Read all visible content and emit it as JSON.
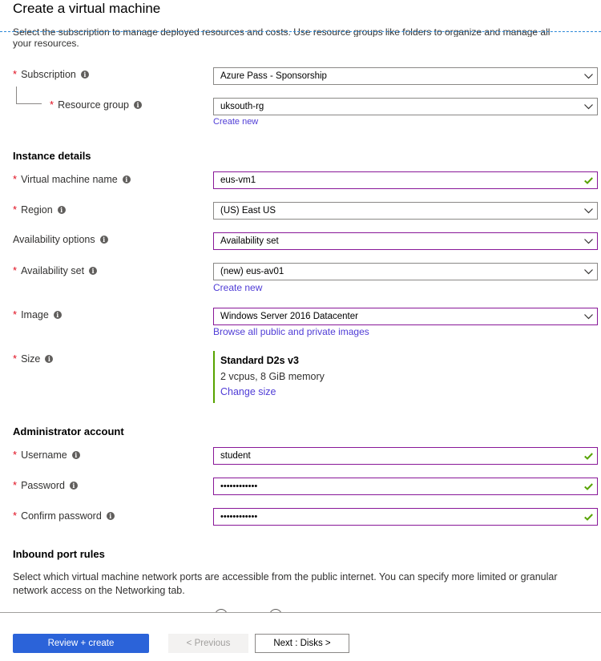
{
  "header": {
    "title": "Create a virtual machine",
    "intro_line1": "Select the subscription to manage deployed resources and costs. Use resource groups like folders to organize and manage all",
    "intro_line2": "your resources."
  },
  "project": {
    "subscription": {
      "label": "Subscription",
      "required": true,
      "value": "Azure Pass - Sponsorship"
    },
    "resource_group": {
      "label": "Resource group",
      "required": true,
      "value": "uksouth-rg",
      "create_new": "Create new"
    }
  },
  "instance": {
    "heading": "Instance details",
    "vm_name": {
      "label": "Virtual machine name",
      "required": true,
      "value": "eus-vm1",
      "valid": true
    },
    "region": {
      "label": "Region",
      "required": true,
      "value": "(US) East US"
    },
    "availability_options": {
      "label": "Availability options",
      "required": false,
      "value": "Availability set"
    },
    "availability_set": {
      "label": "Availability set",
      "required": true,
      "value": "(new) eus-av01",
      "create_new": "Create new"
    },
    "image": {
      "label": "Image",
      "required": true,
      "value": "Windows Server 2016 Datacenter",
      "browse_link": "Browse all public and private images"
    },
    "size": {
      "label": "Size",
      "required": true,
      "name": "Standard D2s v3",
      "desc": "2 vcpus, 8 GiB memory",
      "change_link": "Change size"
    }
  },
  "admin": {
    "heading": "Administrator account",
    "username": {
      "label": "Username",
      "required": true,
      "value": "student",
      "valid": true
    },
    "password": {
      "label": "Password",
      "required": true,
      "value": "••••••••••••",
      "valid": true
    },
    "confirm_password": {
      "label": "Confirm password",
      "required": true,
      "value": "••••••••••••",
      "valid": true
    }
  },
  "inbound": {
    "heading": "Inbound port rules",
    "description": "Select which virtual machine network ports are accessible from the public internet. You can specify more limited or granular network access on the Networking tab."
  },
  "footer": {
    "review_create": "Review + create",
    "previous": "< Previous",
    "next": "Next : Disks >"
  },
  "icons": {
    "required_marker": "*",
    "info": "i"
  },
  "colors": {
    "primary_button": "#2b63d9",
    "link": "#4f3cd6",
    "focus_border": "#881798",
    "valid_check": "#57a300",
    "required": "#e00b1c"
  }
}
